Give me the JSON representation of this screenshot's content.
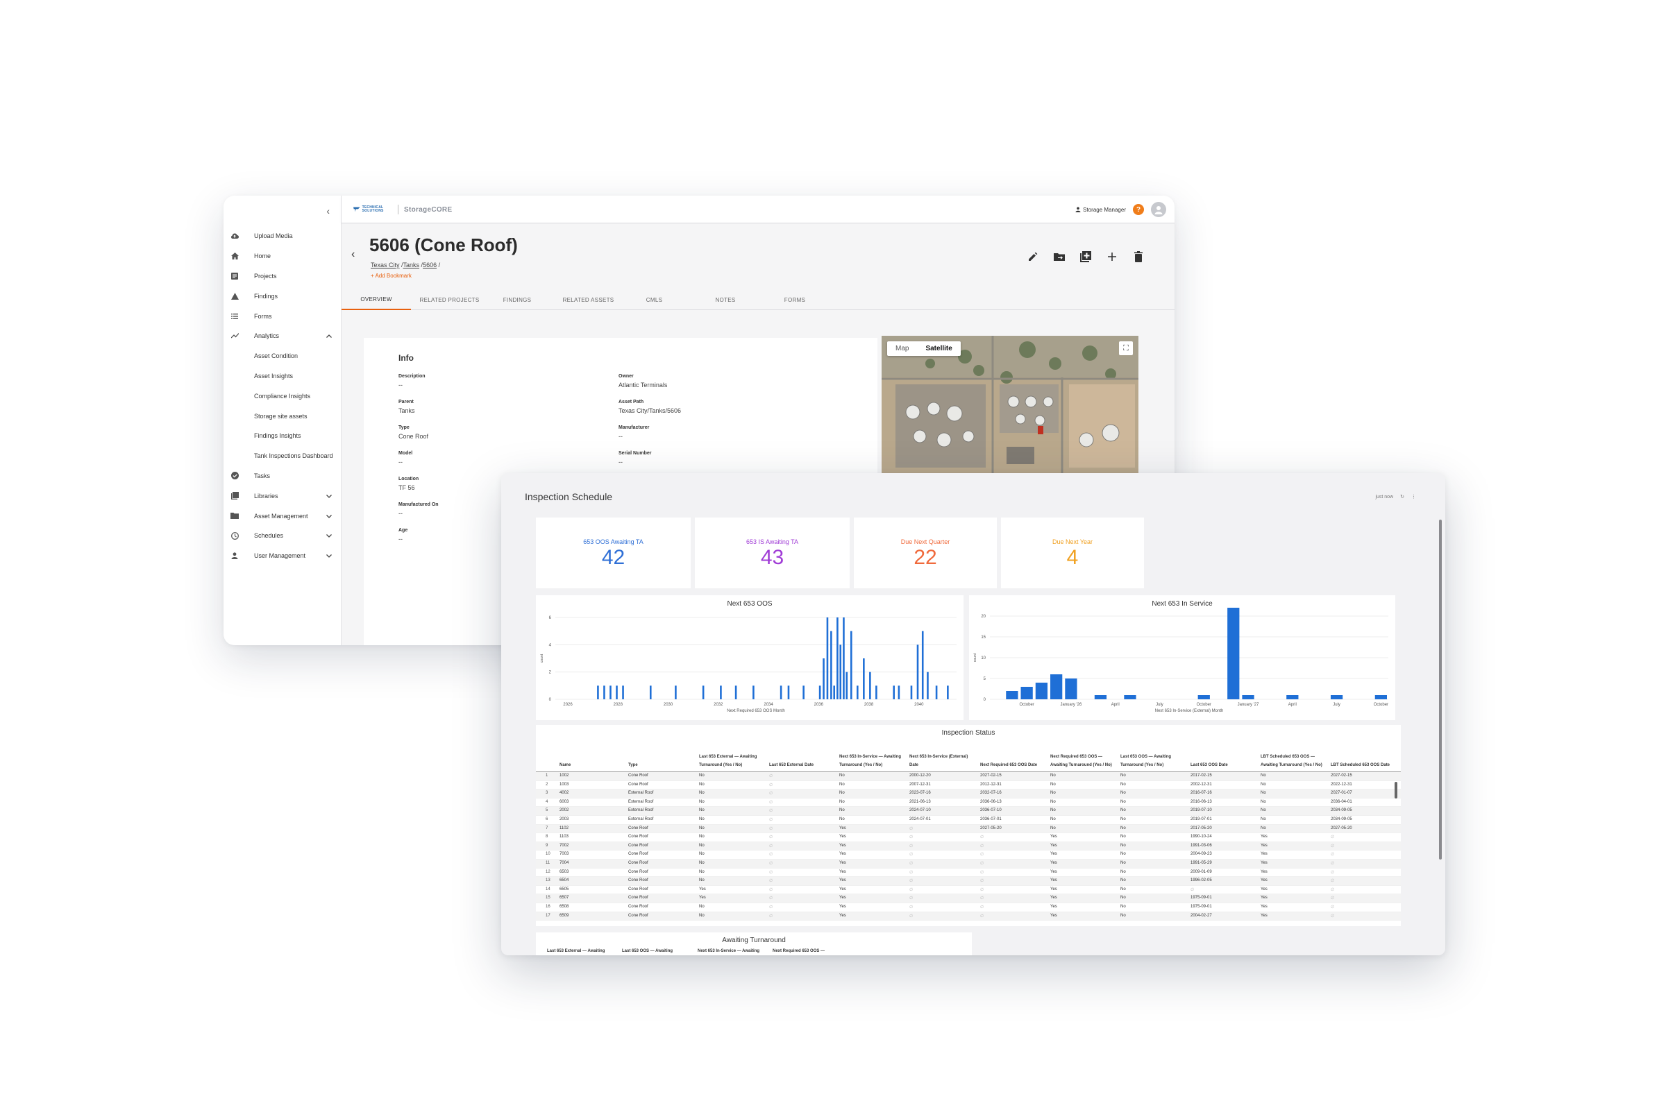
{
  "sidebar": {
    "items": [
      {
        "label": "Upload Media",
        "icon": "cloud-upload-icon"
      },
      {
        "label": "Home",
        "icon": "home-icon"
      },
      {
        "label": "Projects",
        "icon": "projects-icon"
      },
      {
        "label": "Findings",
        "icon": "warning-icon"
      },
      {
        "label": "Forms",
        "icon": "list-icon"
      },
      {
        "label": "Analytics",
        "icon": "analytics-icon",
        "chevron": "up"
      },
      {
        "label": "Asset Condition",
        "sub": true
      },
      {
        "label": "Asset Insights",
        "sub": true
      },
      {
        "label": "Compliance Insights",
        "sub": true
      },
      {
        "label": "Storage site assets",
        "sub": true
      },
      {
        "label": "Findings Insights",
        "sub": true
      },
      {
        "label": "Tank Inspections Dashboard",
        "sub": true
      },
      {
        "label": "Tasks",
        "icon": "check-circle-icon"
      },
      {
        "label": "Libraries",
        "icon": "library-icon",
        "chevron": "down"
      },
      {
        "label": "Asset Management",
        "icon": "folder-icon",
        "chevron": "down"
      },
      {
        "label": "Schedules",
        "icon": "clock-icon",
        "chevron": "down"
      },
      {
        "label": "User Management",
        "icon": "person-icon",
        "chevron": "down"
      }
    ]
  },
  "topbar": {
    "brand_small": "TECHNICAL SOLUTIONS",
    "brand": "StorageCORE",
    "user_role": "Storage Manager",
    "help": "?"
  },
  "asset": {
    "title": "5606 (Cone Roof)",
    "crumb1": "Texas City",
    "crumb2": "Tanks",
    "crumb3": "5606",
    "bookmark": "+ Add Bookmark"
  },
  "tabs": [
    "OVERVIEW",
    "RELATED PROJECTS",
    "FINDINGS",
    "RELATED ASSETS",
    "CMLS",
    "NOTES",
    "FORMS"
  ],
  "info": {
    "title": "Info",
    "left": [
      {
        "k": "Description",
        "v": "--"
      },
      {
        "k": "Parent",
        "v": "Tanks"
      },
      {
        "k": "Type",
        "v": "Cone Roof"
      },
      {
        "k": "Model",
        "v": "--"
      },
      {
        "k": "Location",
        "v": "TF 56"
      },
      {
        "k": "Manufactured On",
        "v": "--"
      },
      {
        "k": "Age",
        "v": "--"
      }
    ],
    "right": [
      {
        "k": "Owner",
        "v": "Atlantic Terminals"
      },
      {
        "k": "Asset Path",
        "v": "Texas City/Tanks/5606"
      },
      {
        "k": "Manufacturer",
        "v": "--"
      },
      {
        "k": "Serial Number",
        "v": "--"
      }
    ]
  },
  "map": {
    "tab_map": "Map",
    "tab_satellite": "Satellite"
  },
  "dashboard": {
    "title": "Inspection Schedule",
    "updated": "just now",
    "kpis": [
      {
        "label": "653 OOS Awaiting TA",
        "value": "42",
        "color": "#2f6fd6"
      },
      {
        "label": "653 IS Awaiting TA",
        "value": "43",
        "color": "#a03cd6"
      },
      {
        "label": "Due Next Quarter",
        "value": "22",
        "color": "#f06a3c"
      },
      {
        "label": "Due Next Year",
        "value": "4",
        "color": "#f0a020"
      }
    ]
  },
  "chart_data": [
    {
      "type": "bar",
      "title": "Next 653 OOS",
      "xlabel": "Next Required 653 OOS Month",
      "ylabel": "count",
      "ylim": [
        0,
        6
      ],
      "yticks": [
        0,
        2,
        4,
        6
      ],
      "xticks": [
        "2026",
        "2028",
        "2030",
        "2032",
        "2034",
        "2036",
        "2038",
        "2040"
      ],
      "xrange": [
        2025.5,
        2041.5
      ],
      "points": [
        [
          2027.2,
          1
        ],
        [
          2027.45,
          1
        ],
        [
          2027.7,
          1
        ],
        [
          2027.95,
          1
        ],
        [
          2028.2,
          1
        ],
        [
          2029.3,
          1
        ],
        [
          2030.3,
          1
        ],
        [
          2031.4,
          1
        ],
        [
          2032.1,
          1
        ],
        [
          2032.7,
          1
        ],
        [
          2033.4,
          1
        ],
        [
          2034.5,
          1
        ],
        [
          2034.8,
          1
        ],
        [
          2035.4,
          1
        ],
        [
          2036.05,
          1
        ],
        [
          2036.2,
          3
        ],
        [
          2036.35,
          6
        ],
        [
          2036.5,
          5
        ],
        [
          2036.62,
          1
        ],
        [
          2036.75,
          6
        ],
        [
          2036.87,
          4
        ],
        [
          2037.0,
          6
        ],
        [
          2037.12,
          2
        ],
        [
          2037.3,
          5
        ],
        [
          2037.55,
          1
        ],
        [
          2037.8,
          3
        ],
        [
          2038.05,
          2
        ],
        [
          2038.3,
          1
        ],
        [
          2039.0,
          1
        ],
        [
          2039.2,
          1
        ],
        [
          2039.7,
          1
        ],
        [
          2039.95,
          4
        ],
        [
          2040.15,
          5
        ],
        [
          2040.35,
          2
        ],
        [
          2040.7,
          1
        ],
        [
          2041.15,
          1
        ]
      ],
      "color": "#1f6fd6"
    },
    {
      "type": "bar",
      "title": "Next 653 In Service",
      "xlabel": "Next 653 In-Service (External) Month",
      "ylabel": "count",
      "ylim": [
        0,
        20
      ],
      "yticks": [
        0,
        5,
        10,
        15,
        20
      ],
      "xticks": [
        "October",
        "January '26",
        "April",
        "July",
        "October",
        "January '27",
        "April",
        "July",
        "October"
      ],
      "categories": [
        "Aug",
        "Sep",
        "Oct",
        "Nov",
        "Dec",
        "Jan",
        "Feb",
        "Mar",
        "Apr",
        "May",
        "Jun",
        "Jul",
        "Aug",
        "Sep",
        "Oct",
        "Nov",
        "Dec",
        "Jan",
        "Feb",
        "Mar",
        "Apr",
        "May",
        "Jun",
        "Jul",
        "Aug",
        "Sep",
        "Oct"
      ],
      "values": [
        0,
        2,
        3,
        4,
        6,
        5,
        0,
        1,
        0,
        1,
        0,
        0,
        0,
        0,
        1,
        0,
        22,
        1,
        0,
        0,
        1,
        0,
        0,
        1,
        0,
        0,
        1
      ],
      "color": "#1f6fd6"
    }
  ],
  "inspection_status": {
    "title": "Inspection Status",
    "columns": [
      "",
      "Name",
      "Type",
      "Last 653 External — Awaiting Turnaround (Yes / No)",
      "Last 653 External Date",
      "Next 653 In-Service — Awaiting Turnaround (Yes / No)",
      "Next 653 In-Service (External) Date",
      "Next Required 653 OOS Date",
      "Next Required 653 OOS — Awaiting Turnaround (Yes / No)",
      "Last 653 OOS — Awaiting Turnaround (Yes / No)",
      "Last 653 OOS Date",
      "LBT Scheduled 653 OOS — Awaiting Turnaround (Yes / No)",
      "LBT Scheduled 653 OOS Date"
    ],
    "rows": [
      [
        "1",
        "1002",
        "Cone Roof",
        "No",
        "∅",
        "No",
        "2000-12-20",
        "2027-02-15",
        "No",
        "No",
        "2017-02-15",
        "No",
        "2027-02-15"
      ],
      [
        "2",
        "1003",
        "Cone Roof",
        "No",
        "∅",
        "No",
        "2007-12-31",
        "2012-12-31",
        "No",
        "No",
        "2002-12-31",
        "No",
        "2022-12-31"
      ],
      [
        "3",
        "4002",
        "External Roof",
        "No",
        "∅",
        "No",
        "2023-07-16",
        "2032-07-16",
        "No",
        "No",
        "2016-07-16",
        "No",
        "2027-01-07"
      ],
      [
        "4",
        "6003",
        "External Roof",
        "No",
        "∅",
        "No",
        "2021-06-13",
        "2036-06-13",
        "No",
        "No",
        "2016-06-13",
        "No",
        "2036-04-01"
      ],
      [
        "5",
        "2002",
        "External Roof",
        "No",
        "∅",
        "No",
        "2024-07-10",
        "2036-07-10",
        "No",
        "No",
        "2019-07-10",
        "No",
        "2034-09-05"
      ],
      [
        "6",
        "2003",
        "External Roof",
        "No",
        "∅",
        "No",
        "2024-07-01",
        "2036-07-01",
        "No",
        "No",
        "2019-07-01",
        "No",
        "2034-09-05"
      ],
      [
        "7",
        "1102",
        "Cone Roof",
        "No",
        "∅",
        "Yes",
        "∅",
        "2027-05-20",
        "No",
        "No",
        "2017-05-20",
        "No",
        "2027-05-20"
      ],
      [
        "8",
        "1103",
        "Cone Roof",
        "No",
        "∅",
        "Yes",
        "∅",
        "∅",
        "Yes",
        "No",
        "1990-10-24",
        "Yes",
        "∅"
      ],
      [
        "9",
        "7002",
        "Cone Roof",
        "No",
        "∅",
        "Yes",
        "∅",
        "∅",
        "Yes",
        "No",
        "1991-03-06",
        "Yes",
        "∅"
      ],
      [
        "10",
        "7003",
        "Cone Roof",
        "No",
        "∅",
        "Yes",
        "∅",
        "∅",
        "Yes",
        "No",
        "2004-09-23",
        "Yes",
        "∅"
      ],
      [
        "11",
        "7004",
        "Cone Roof",
        "No",
        "∅",
        "Yes",
        "∅",
        "∅",
        "Yes",
        "No",
        "1991-05-29",
        "Yes",
        "∅"
      ],
      [
        "12",
        "6503",
        "Cone Roof",
        "No",
        "∅",
        "Yes",
        "∅",
        "∅",
        "Yes",
        "No",
        "2009-01-09",
        "Yes",
        "∅"
      ],
      [
        "13",
        "6504",
        "Cone Roof",
        "No",
        "∅",
        "Yes",
        "∅",
        "∅",
        "Yes",
        "No",
        "1996-02-05",
        "Yes",
        "∅"
      ],
      [
        "14",
        "6505",
        "Cone Roof",
        "Yes",
        "∅",
        "Yes",
        "∅",
        "∅",
        "Yes",
        "No",
        "∅",
        "Yes",
        "∅"
      ],
      [
        "15",
        "6507",
        "Cone Roof",
        "Yes",
        "∅",
        "Yes",
        "∅",
        "∅",
        "Yes",
        "No",
        "1975-09-01",
        "Yes",
        "∅"
      ],
      [
        "16",
        "6508",
        "Cone Roof",
        "No",
        "∅",
        "Yes",
        "∅",
        "∅",
        "Yes",
        "No",
        "1975-09-01",
        "Yes",
        "∅"
      ],
      [
        "17",
        "6509",
        "Cone Roof",
        "No",
        "∅",
        "Yes",
        "∅",
        "∅",
        "Yes",
        "No",
        "2004-02-27",
        "Yes",
        "∅"
      ]
    ]
  },
  "awaiting": {
    "title": "Awaiting Turnaround",
    "columns": [
      "Last 653 External — Awaiting",
      "Last 653 OOS — Awaiting",
      "Next 653 In-Service — Awaiting",
      "Next Required 653 OOS —"
    ]
  }
}
